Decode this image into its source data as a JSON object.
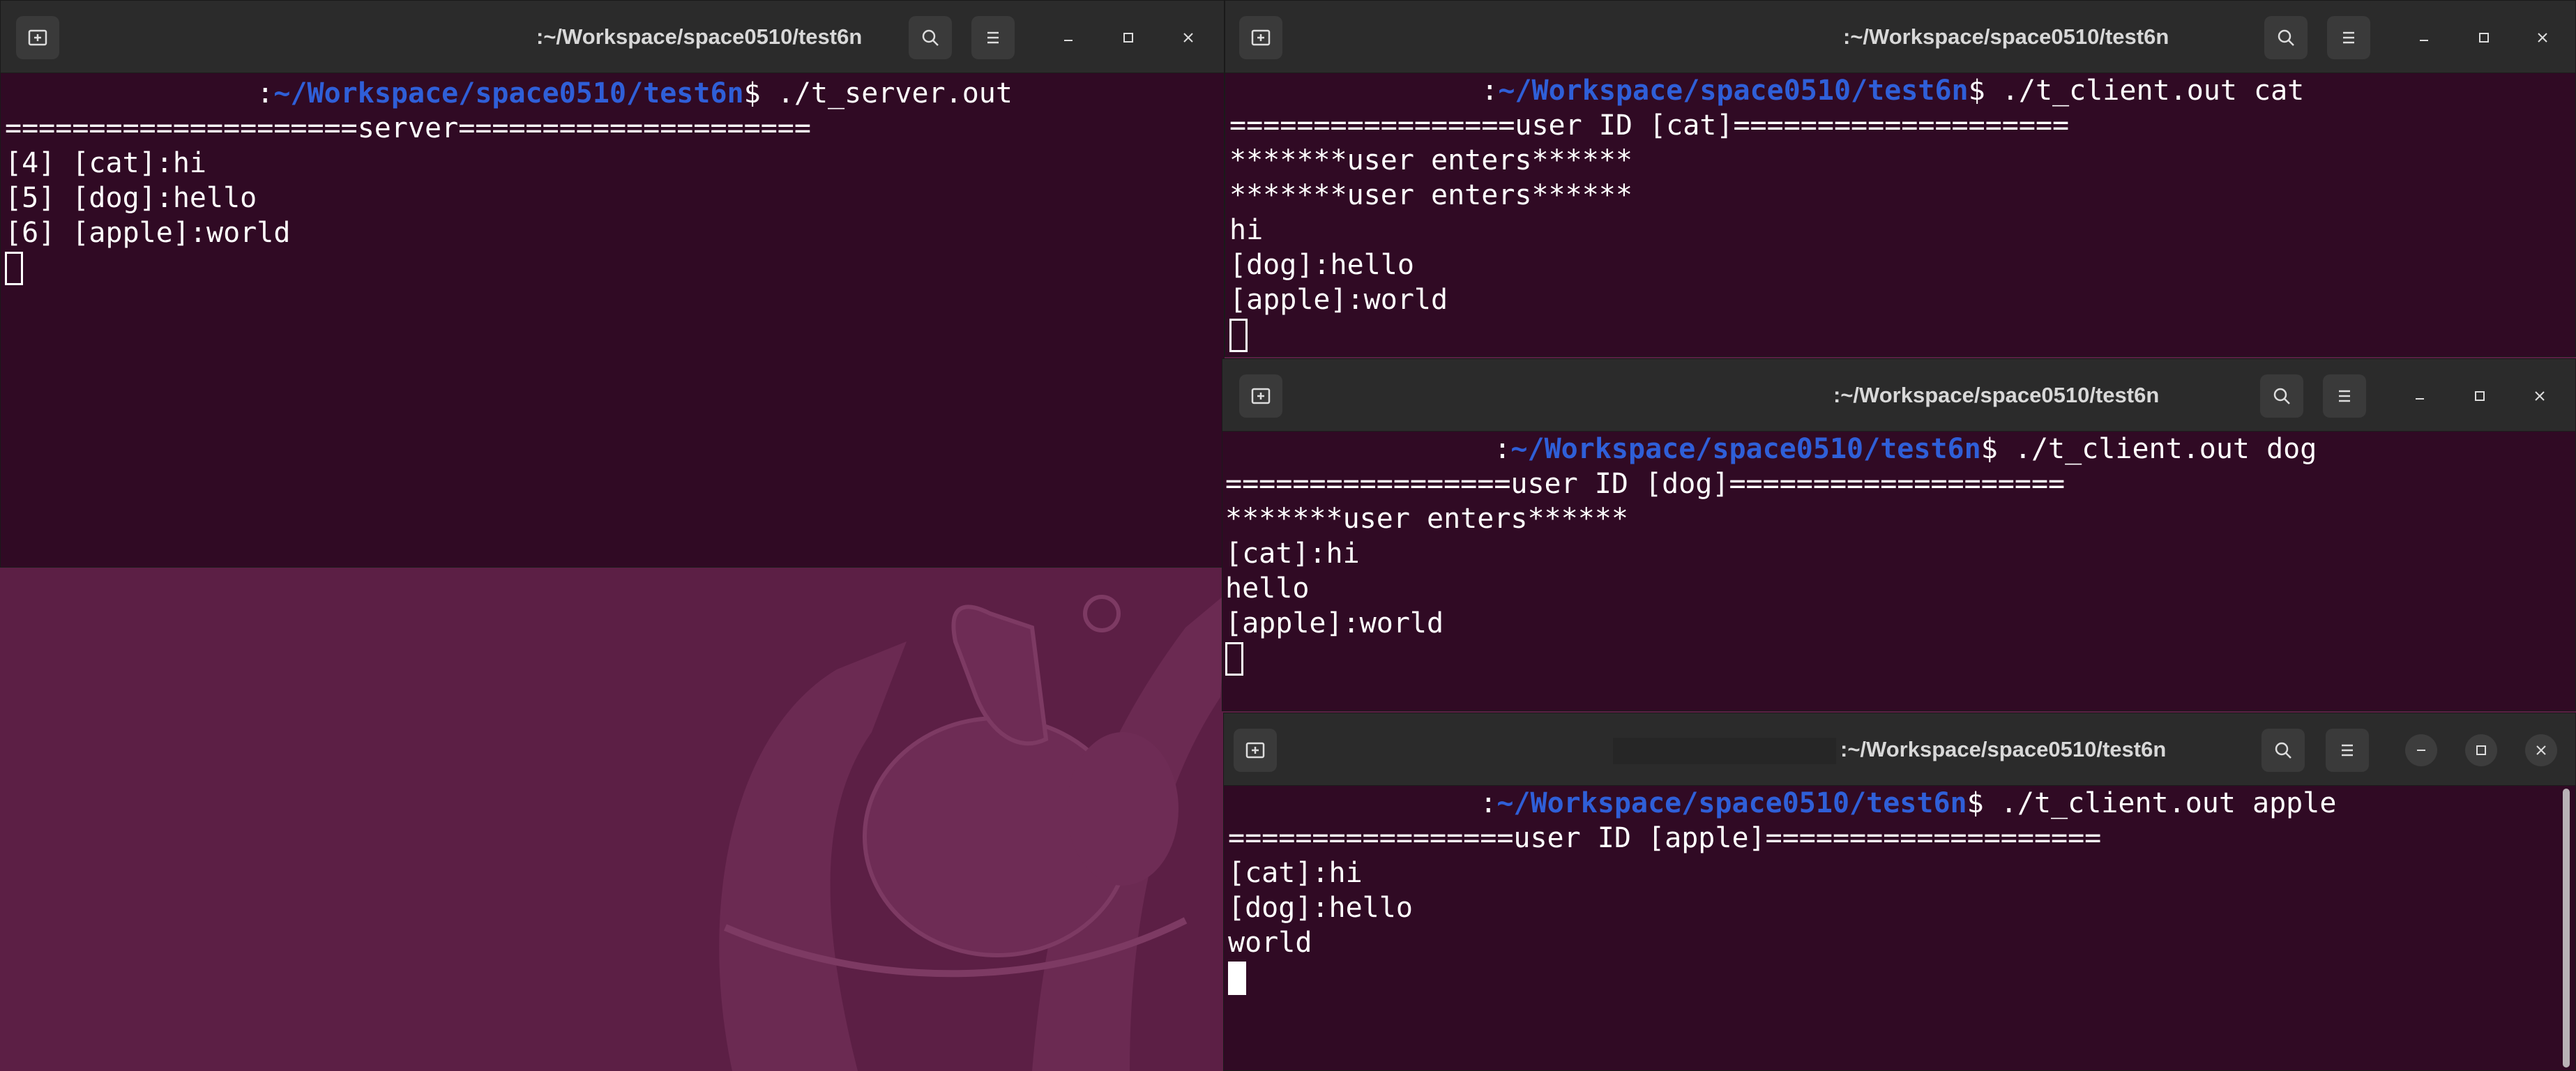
{
  "colors": {
    "terminal_bg": "#300a24",
    "titlebar_bg": "#2b2b2b",
    "prompt_path": "#2f5fd8",
    "desktop_bg": "#5c1f45"
  },
  "icons": {
    "new_tab": "new-tab-icon",
    "search": "search-icon",
    "menu": "hamburger-menu-icon",
    "minimize": "minimize-icon",
    "maximize": "maximize-icon",
    "close": "close-icon"
  },
  "windows": {
    "server": {
      "title": ":~/Workspace/space0510/test6n",
      "prompt_prefix": ":",
      "prompt_path": "~/Workspace/space0510/test6n",
      "command": "$ ./t_server.out",
      "lines": [
        "=====================server=====================",
        "[4] [cat]:hi",
        "[5] [dog]:hello",
        "[6] [apple]:world"
      ]
    },
    "cat": {
      "title": ":~/Workspace/space0510/test6n",
      "prompt_prefix": ":",
      "prompt_path": "~/Workspace/space0510/test6n",
      "command": "$ ./t_client.out cat",
      "lines": [
        "=================user ID [cat]====================",
        "*******user enters******",
        "*******user enters******",
        "hi",
        "[dog]:hello",
        "[apple]:world"
      ]
    },
    "dog": {
      "title": ":~/Workspace/space0510/test6n",
      "prompt_prefix": ":",
      "prompt_path": "~/Workspace/space0510/test6n",
      "command": "$ ./t_client.out dog",
      "lines": [
        "=================user ID [dog]====================",
        "*******user enters******",
        "[cat]:hi",
        "hello",
        "[apple]:world"
      ]
    },
    "apple": {
      "title": ":~/Workspace/space0510/test6n",
      "prompt_prefix": ":",
      "prompt_path": "~/Workspace/space0510/test6n",
      "command": "$ ./t_client.out apple",
      "lines": [
        "=================user ID [apple]====================",
        "[cat]:hi",
        "[dog]:hello",
        "world"
      ]
    }
  }
}
